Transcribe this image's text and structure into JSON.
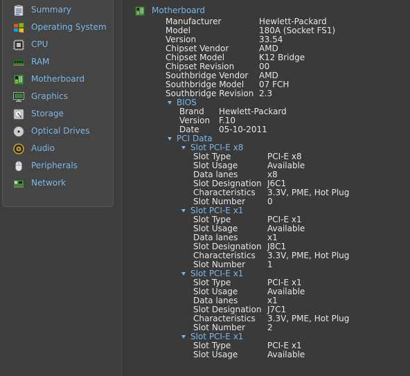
{
  "sidebar": {
    "items": [
      {
        "label": "Summary",
        "icon": "clipboard-icon"
      },
      {
        "label": "Operating System",
        "icon": "windows-logo-icon"
      },
      {
        "label": "CPU",
        "icon": "cpu-chip-icon"
      },
      {
        "label": "RAM",
        "icon": "ram-module-icon"
      },
      {
        "label": "Motherboard",
        "icon": "motherboard-icon"
      },
      {
        "label": "Graphics",
        "icon": "monitor-icon"
      },
      {
        "label": "Storage",
        "icon": "hard-drive-icon"
      },
      {
        "label": "Optical Drives",
        "icon": "optical-disc-icon"
      },
      {
        "label": "Audio",
        "icon": "speaker-icon"
      },
      {
        "label": "Peripherals",
        "icon": "mouse-icon"
      },
      {
        "label": "Network",
        "icon": "network-card-icon"
      }
    ]
  },
  "content": {
    "title": "Motherboard",
    "props": [
      {
        "k": "Manufacturer",
        "v": "Hewlett-Packard"
      },
      {
        "k": "Model",
        "v": "180A (Socket FS1)"
      },
      {
        "k": "Version",
        "v": "33.54"
      },
      {
        "k": "Chipset Vendor",
        "v": "AMD"
      },
      {
        "k": "Chipset Model",
        "v": "K12 Bridge"
      },
      {
        "k": "Chipset Revision",
        "v": "00"
      },
      {
        "k": "Southbridge Vendor",
        "v": "AMD"
      },
      {
        "k": "Southbridge Model",
        "v": "07 FCH"
      },
      {
        "k": "Southbridge Revision",
        "v": "2.3"
      }
    ],
    "bios": {
      "label": "BIOS",
      "props": [
        {
          "k": "Brand",
          "v": "Hewlett-Packard"
        },
        {
          "k": "Version",
          "v": "F.10"
        },
        {
          "k": "Date",
          "v": "05-10-2011"
        }
      ]
    },
    "pci": {
      "label": "PCI Data",
      "slots": [
        {
          "label": "Slot PCI-E x8",
          "props": [
            {
              "k": "Slot Type",
              "v": "PCI-E x8"
            },
            {
              "k": "Slot Usage",
              "v": "Available"
            },
            {
              "k": "Data lanes",
              "v": "x8"
            },
            {
              "k": "Slot Designation",
              "v": "J6C1"
            },
            {
              "k": "Characteristics",
              "v": "3.3V, PME, Hot Plug"
            },
            {
              "k": "Slot Number",
              "v": "0"
            }
          ]
        },
        {
          "label": "Slot PCI-E x1",
          "props": [
            {
              "k": "Slot Type",
              "v": "PCI-E x1"
            },
            {
              "k": "Slot Usage",
              "v": "Available"
            },
            {
              "k": "Data lanes",
              "v": "x1"
            },
            {
              "k": "Slot Designation",
              "v": "J8C1"
            },
            {
              "k": "Characteristics",
              "v": "3.3V, PME, Hot Plug"
            },
            {
              "k": "Slot Number",
              "v": "1"
            }
          ]
        },
        {
          "label": "Slot PCI-E x1",
          "props": [
            {
              "k": "Slot Type",
              "v": "PCI-E x1"
            },
            {
              "k": "Slot Usage",
              "v": "Available"
            },
            {
              "k": "Data lanes",
              "v": "x1"
            },
            {
              "k": "Slot Designation",
              "v": "J7C1"
            },
            {
              "k": "Characteristics",
              "v": "3.3V, PME, Hot Plug"
            },
            {
              "k": "Slot Number",
              "v": "2"
            }
          ]
        },
        {
          "label": "Slot PCI-E x1",
          "props": [
            {
              "k": "Slot Type",
              "v": "PCI-E x1"
            },
            {
              "k": "Slot Usage",
              "v": "Available"
            }
          ]
        }
      ]
    }
  },
  "colors": {
    "background": "#3a3a3a",
    "sidebar_panel": "#454545",
    "link_blue": "#79b7e6",
    "text": "#e6e6e6"
  }
}
